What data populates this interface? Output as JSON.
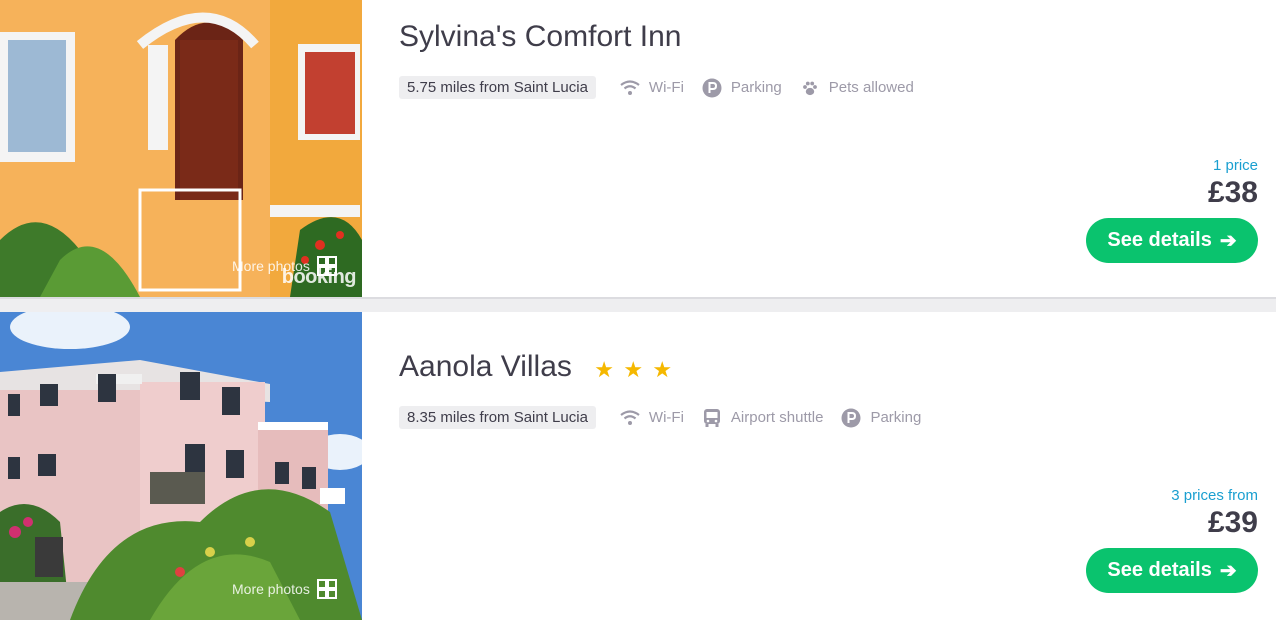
{
  "hotels": [
    {
      "name": "Sylvina's Comfort Inn",
      "stars": [],
      "distance": "5.75 miles from Saint Lucia",
      "amenities": [
        {
          "icon": "wifi-icon",
          "label": "Wi-Fi"
        },
        {
          "icon": "parking-icon",
          "label": "Parking"
        },
        {
          "icon": "paw-icon",
          "label": "Pets allowed"
        }
      ],
      "price_note": "1 price",
      "price": "£38",
      "cta": "See details",
      "more_photos": "More photos",
      "watermark": "booking"
    },
    {
      "name": "Aanola Villas",
      "stars": [
        "★",
        "★",
        "★"
      ],
      "distance": "8.35 miles from Saint Lucia",
      "amenities": [
        {
          "icon": "wifi-icon",
          "label": "Wi-Fi"
        },
        {
          "icon": "bus-icon",
          "label": "Airport shuttle"
        },
        {
          "icon": "parking-icon",
          "label": "Parking"
        }
      ],
      "price_note": "3 prices from",
      "price": "£39",
      "cta": "See details",
      "more_photos": "More photos"
    }
  ],
  "colors": {
    "accent_green": "#0ac36e",
    "price_note_blue": "#1a9fd0",
    "star_gold": "#f5b800",
    "text_dark": "#3f3d4a",
    "text_muted": "#9d9aa8"
  }
}
